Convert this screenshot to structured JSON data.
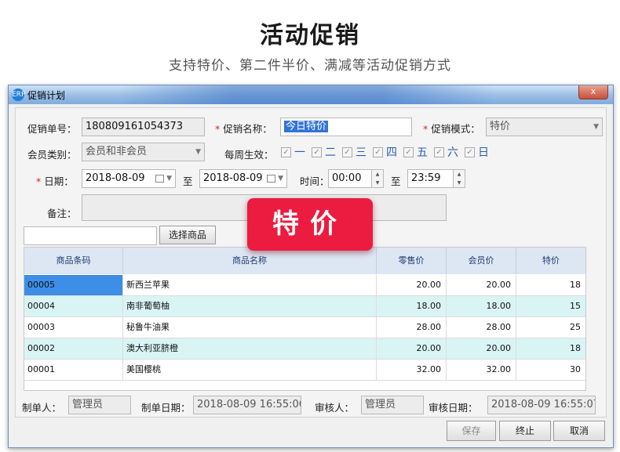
{
  "hero": {
    "title": "活动促销",
    "subtitle": "支持特价、第二件半价、满减等活动促销方式"
  },
  "window": {
    "icon_text": "ERP",
    "title": "促销计划",
    "close_label": "x"
  },
  "form": {
    "order_no_label": "促销单号：",
    "order_no": "180809161054373",
    "promo_name_label": "促销名称：",
    "promo_name": "今日特价",
    "promo_mode_label": "促销模式：",
    "promo_mode": "特价",
    "member_type_label": "会员类别：",
    "member_type": "会员和非会员",
    "weekly_label": "每周生效：",
    "weekdays": [
      {
        "label": "一",
        "checked": true
      },
      {
        "label": "二",
        "checked": true
      },
      {
        "label": "三",
        "checked": true
      },
      {
        "label": "四",
        "checked": true
      },
      {
        "label": "五",
        "checked": true
      },
      {
        "label": "六",
        "checked": true
      },
      {
        "label": "日",
        "checked": true
      }
    ],
    "check_mark": "✓",
    "date_label": "日期：",
    "date_from": "2018-08-09",
    "to_label": "至",
    "date_to": "2018-08-09",
    "time_label": "时间：",
    "time_from": "00:00",
    "time_to": "23:59",
    "remark_label": "备注：",
    "remark": "",
    "search_value": "",
    "select_goods_button": "选择商品",
    "required_mark": "*"
  },
  "promo_badge": "特价",
  "grid": {
    "columns": [
      "商品条码",
      "商品名称",
      "零售价",
      "会员价",
      "特价"
    ],
    "rows": [
      {
        "code": "00005",
        "name": "新西兰苹果",
        "retail": "20.00",
        "member": "20.00",
        "special": "18"
      },
      {
        "code": "00004",
        "name": "南非葡萄柚",
        "retail": "18.00",
        "member": "18.00",
        "special": "15"
      },
      {
        "code": "00003",
        "name": "秘鲁牛油果",
        "retail": "28.00",
        "member": "28.00",
        "special": "25"
      },
      {
        "code": "00002",
        "name": "澳大利亚脐橙",
        "retail": "20.00",
        "member": "20.00",
        "special": "18"
      },
      {
        "code": "00001",
        "name": "美国樱桃",
        "retail": "32.00",
        "member": "32.00",
        "special": "30"
      }
    ]
  },
  "footer": {
    "maker_label": "制单人：",
    "maker": "管理员",
    "make_date_label": "制单日期：",
    "make_date": "2018-08-09 16:55:06",
    "auditor_label": "审核人：",
    "auditor": "管理员",
    "audit_date_label": "审核日期：",
    "audit_date": "2018-08-09 16:55:07"
  },
  "buttons": {
    "save": "保存",
    "terminate": "终止",
    "cancel": "取消"
  },
  "colors": {
    "badge": "#ec1c40",
    "grid_header": "#dde7f4",
    "row_alt": "#d9f4f5",
    "selection": "#3374d6"
  }
}
